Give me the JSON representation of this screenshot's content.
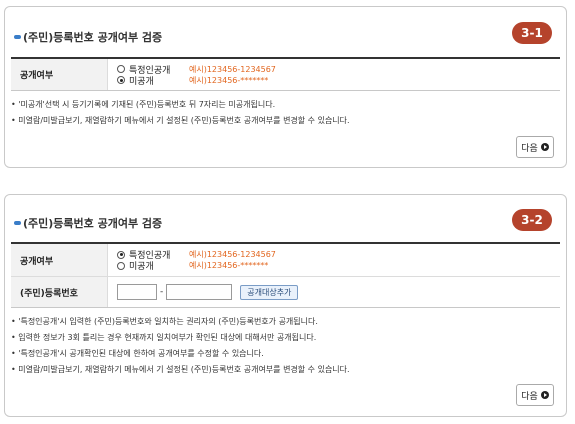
{
  "panel1": {
    "title": "(주민)등록번호 공개여부 검증",
    "step": "3-1",
    "field_label": "공개여부",
    "options": [
      {
        "label": "특정인공개",
        "example": "예시)123456-1234567",
        "selected": false
      },
      {
        "label": "미공개",
        "example": "예시)123456-*******",
        "selected": true
      }
    ],
    "notes": [
      "'미공개'선택 시 등기기록에 기재된 (주민)등록번호 뒤 7자리는 미공개됩니다.",
      "미열람/미발급보기, 재열람하기 메뉴에서 기 설정된 (주민)등록번호 공개여부를 변경할 수 있습니다."
    ],
    "next_label": "다음"
  },
  "panel2": {
    "title": "(주민)등록번호 공개여부 검증",
    "step": "3-2",
    "field_label": "공개여부",
    "options": [
      {
        "label": "특정인공개",
        "example": "예시)123456-1234567",
        "selected": true
      },
      {
        "label": "미공개",
        "example": "예시)123456-*******",
        "selected": false
      }
    ],
    "id_label": "(주민)등록번호",
    "id_front_value": "",
    "id_back_value": "",
    "dash": "-",
    "add_button_label": "공개대상추가",
    "notes": [
      "'특정인공개'시 입력한 (주민)등록번호와 일치하는 권리자의 (주민)등록번호가 공개됩니다.",
      "입력한 정보가 3회 틀리는 경우 현재까지 일치여부가 확인된 대상에 대해서만 공개됩니다.",
      "'특정인공개'시 공개확인된 대상에 한하여 공개여부를 수정할 수 있습니다.",
      "미열람/미발급보기, 재열람하기 메뉴에서 기 설정된 (주민)등록번호 공개여부를 변경할 수 있습니다."
    ],
    "next_label": "다음"
  },
  "colors": {
    "step_badge": "#b5432c",
    "example_text": "#e2661f",
    "title_dot": "#3a7dc8"
  }
}
